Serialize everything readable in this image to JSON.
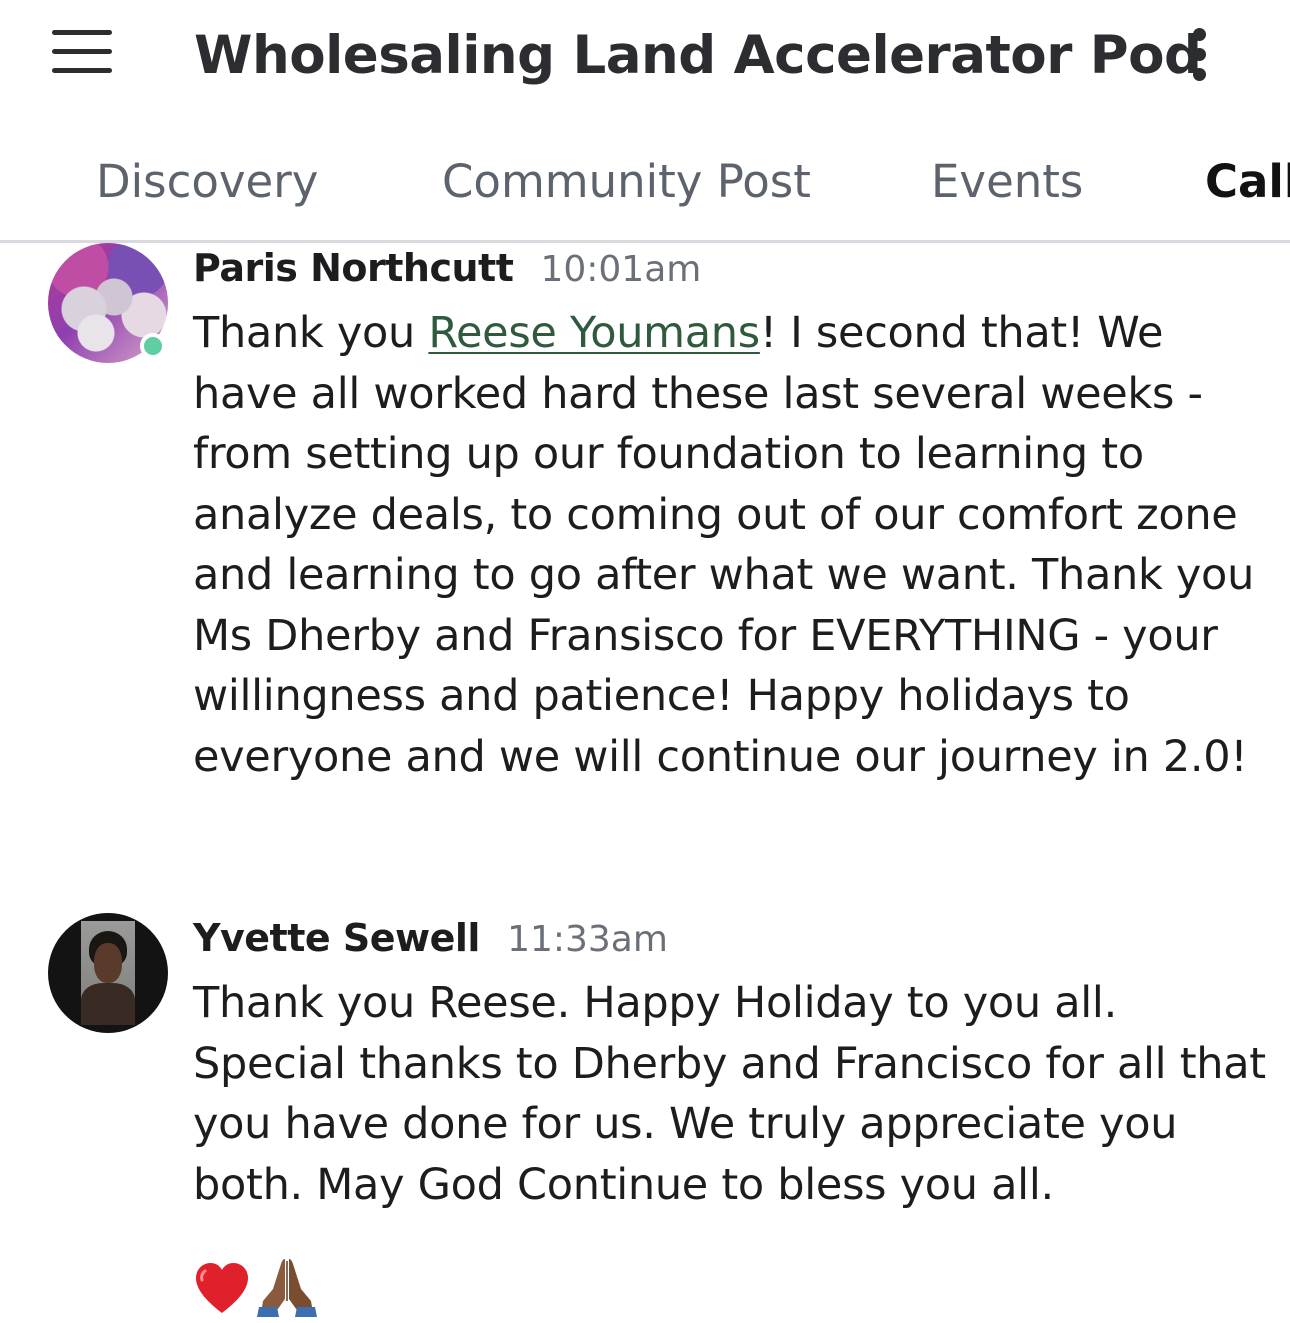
{
  "header": {
    "title": "Wholesaling Land Accelerator Pod",
    "menu_icon": "hamburger-icon",
    "more_icon": "vertical-ellipsis-icon"
  },
  "tabs": [
    {
      "label": "Discovery",
      "active": false
    },
    {
      "label": "Community Post",
      "active": false
    },
    {
      "label": "Events",
      "active": false
    },
    {
      "label": "Call",
      "active": true
    }
  ],
  "messages": [
    {
      "author": "Paris Northcutt",
      "time": "10:01am",
      "online": true,
      "text_before": "Thank you ",
      "mention": "Reese Youmans",
      "text_after": "! I second that! We have all worked hard these last several weeks - from setting up our foundation to learning to analyze deals, to coming out of our comfort zone and learning to go after what we want. Thank you Ms Dherby and Fransisco for EVERYTHING - your willingness and patience! Happy holidays to everyone and we will continue our journey in 2.0!"
    },
    {
      "author": "Yvette Sewell",
      "time": "11:33am",
      "online": false,
      "text": "Thank you Reese. Happy Holiday to you all. Special thanks to Dherby and Francisco for all that you have done for us. We truly appreciate you both. May God Continue to bless you all.",
      "emojis": [
        "red-heart-icon",
        "folded-hands-icon"
      ]
    }
  ],
  "colors": {
    "online": "#5fcfa3",
    "mention": "#2f5a3d",
    "tab_inactive": "#5d636d",
    "tab_active": "#111214",
    "timestamp": "#6b7078"
  }
}
